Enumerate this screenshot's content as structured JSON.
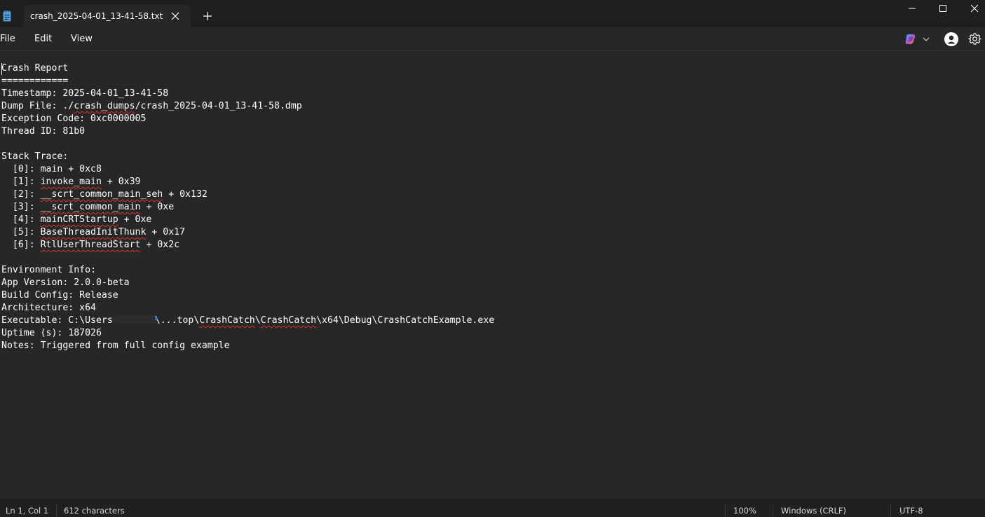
{
  "window": {
    "tab_title": "crash_2025-04-01_13-41-58.txt"
  },
  "menu": {
    "file": "File",
    "edit": "Edit",
    "view": "View"
  },
  "editor": {
    "lines": [
      "Crash Report",
      "============",
      "Timestamp: 2025-04-01_13-41-58",
      "Dump File: ./crash_dumps/crash_2025-04-01_13-41-58.dmp",
      "Exception Code: 0xc0000005",
      "Thread ID: 81b0",
      "",
      "Stack Trace:",
      "  [0]: main + 0xc8",
      "  [1]: invoke_main + 0x39",
      "  [2]: __scrt_common_main_seh + 0x132",
      "  [3]: __scrt_common_main + 0xe",
      "  [4]: mainCRTStartup + 0xe",
      "  [5]: BaseThreadInitThunk + 0x17",
      "  [6]: RtlUserThreadStart + 0x2c",
      "",
      "Environment Info:",
      "App Version: 2.0.0-beta",
      "Build Config: Release",
      "Architecture: x64",
      "Executable: C:\\Users\\",
      "Uptime (s): 187026",
      "Notes: Triggered from full config example"
    ],
    "executable_prefix": "Executable: C:\\Users",
    "executable_partial": "\\...top\\",
    "executable_suffix_1": "CrashCatch",
    "executable_sep_1": "\\",
    "executable_suffix_2": "CrashCatch",
    "executable_suffix_3": "\\x64\\Debug\\CrashCatchExample.exe"
  },
  "status": {
    "position": "Ln 1, Col 1",
    "characters": "612 characters",
    "zoom": "100%",
    "line_endings": "Windows (CRLF)",
    "encoding": "UTF-8"
  },
  "icons": {
    "app": "notepad-icon",
    "close_tab": "close-icon",
    "new_tab": "plus-icon",
    "copilot": "copilot-icon",
    "account": "account-icon",
    "settings": "gear-icon"
  },
  "colors": {
    "background": "#272727",
    "titlebar": "#1f1f1f",
    "statusbar": "#202020",
    "spellcheck": "#e0342a",
    "app_icon": "#4a9bd9"
  }
}
